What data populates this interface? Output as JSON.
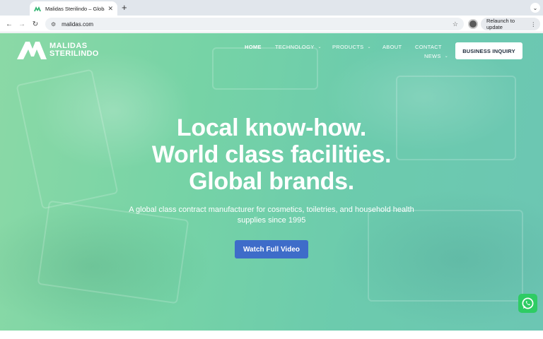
{
  "browser": {
    "tab_title": "Malidas Sterilindo – Global C",
    "new_tab": "+",
    "url": "malidas.com",
    "relaunch_label": "Relaunch to update"
  },
  "site": {
    "logo_line1": "MALIDAS",
    "logo_line2": "STERILINDO",
    "nav": {
      "home": "HOME",
      "technology": "TECHNOLOGY",
      "products": "PRODUCTS",
      "about": "ABOUT",
      "contact": "CONTACT",
      "news": "NEWS"
    },
    "inquiry_label": "BUSINESS INQUIRY"
  },
  "hero": {
    "line1": "Local know-how.",
    "line2": "World class facilities.",
    "line3": "Global brands.",
    "subtitle": "A global class contract manufacturer for cosmetics, toiletries, and household health supplies since 1995",
    "cta_label": "Watch Full Video"
  },
  "colors": {
    "accent_button": "#3e6cc9",
    "hero_green": "#76d3a6",
    "whatsapp": "#2ecc64"
  },
  "icons": [
    "back-icon",
    "forward-icon",
    "reload-icon",
    "site-settings-icon",
    "star-icon",
    "profile-avatar",
    "more-vert-icon",
    "chevron-down-icon",
    "whatsapp-icon"
  ]
}
